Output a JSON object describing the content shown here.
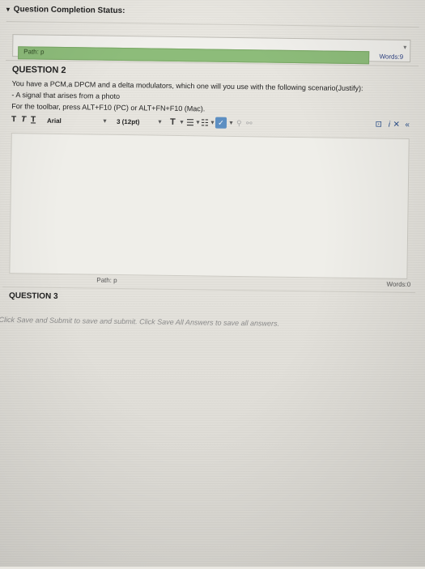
{
  "status": {
    "toggle_glyph": "▾",
    "title": "Question Completion Status:"
  },
  "top_editor": {
    "path": "Path: p",
    "words": "Words:9"
  },
  "question2": {
    "title": "QUESTION 2",
    "prompt": "You have a PCM,a DPCM and a delta modulators, which one will you use with the following scenario(Justify):",
    "scenario": "- A signal that arises from a photo",
    "toolbar_hint": "For the toolbar, press ALT+F10 (PC) or ALT+FN+F10 (Mac)."
  },
  "toolbar": {
    "format_buttons": [
      "T",
      "T",
      "T"
    ],
    "font_family": "Arial",
    "font_size": "3 (12pt)",
    "text_color_glyph": "T",
    "list_glyph": "☰",
    "ordered_list_glyph": "☷",
    "spellcheck_glyph": "✓",
    "link_glyph": "⚲",
    "unlink_glyph": "⚯",
    "right_icons": [
      "⊡",
      "i",
      "✕",
      "«"
    ]
  },
  "bottom_editor": {
    "path": "Path: p",
    "words": "Words:0"
  },
  "question3": {
    "title": "QUESTION 3"
  },
  "footer": {
    "note": "Click Save and Submit to save and submit. Click Save All Answers to save all answers."
  }
}
